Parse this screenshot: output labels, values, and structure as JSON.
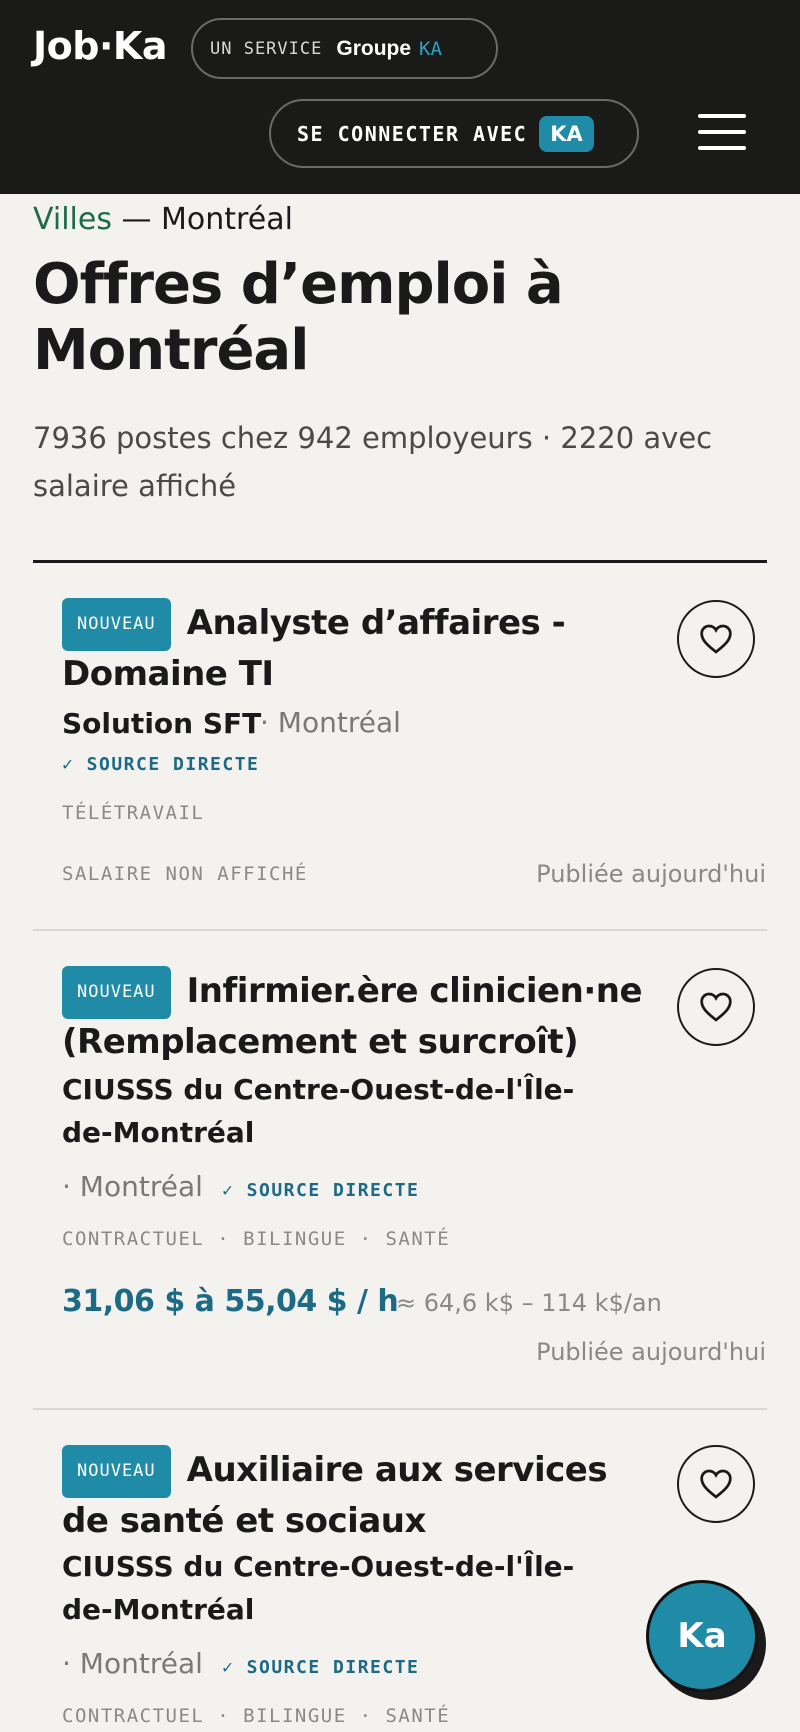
{
  "header": {
    "logo": "Job·Ka",
    "service_prefix": "UN SERVICE",
    "service_groupe": "Groupe",
    "service_ka": "KA",
    "connect_label": "SE CONNECTER AVEC",
    "connect_badge": "KA"
  },
  "breadcrumb": {
    "link": "Villes",
    "separator": " — ",
    "current": "Montréal"
  },
  "page_title": "Offres d’emploi à Montréal",
  "summary": "7936 postes chez 942 employeurs · 2220 avec salaire affiché",
  "jobs": [
    {
      "badge": "NOUVEAU",
      "title": "Analyste d’affaires - Domaine TI",
      "employer": "Solution SFT",
      "location": "· Montréal",
      "source": "✓ SOURCE DIRECTE",
      "tags": "TÉLÉTRAVAIL",
      "salary_none": "SALAIRE NON AFFICHÉ",
      "published": "Publiée aujourd'hui"
    },
    {
      "badge": "NOUVEAU",
      "title": "Infirmier.ère clinicien·ne (Remplacement et surcroît)",
      "employer": "CIUSSS du Centre-Ouest-de-l'Île-de-Montréal",
      "location": "· Montréal",
      "source": "✓ SOURCE DIRECTE",
      "tags": "CONTRACTUEL · BILINGUE · SANTÉ",
      "salary": "31,06 $ à 55,04 $ / h",
      "salary_annual": "≈ 64,6 k$ – 114 k$/an",
      "published": "Publiée aujourd'hui"
    },
    {
      "badge": "NOUVEAU",
      "title": "Auxiliaire aux services de santé et sociaux",
      "employer": "CIUSSS du Centre-Ouest-de-l'Île-de-Montréal",
      "location": "· Montréal",
      "source": "✓ SOURCE DIRECTE",
      "tags": "CONTRACTUEL · BILINGUE · SANTÉ"
    }
  ],
  "fab_label": "Ka",
  "icons": {
    "menu": "hamburger-menu-icon",
    "favorite": "heart-icon"
  },
  "colors": {
    "accent": "#1f8ba6",
    "header_bg": "#1a1a19",
    "link": "#1e6b4a",
    "salary": "#1d6a86"
  }
}
